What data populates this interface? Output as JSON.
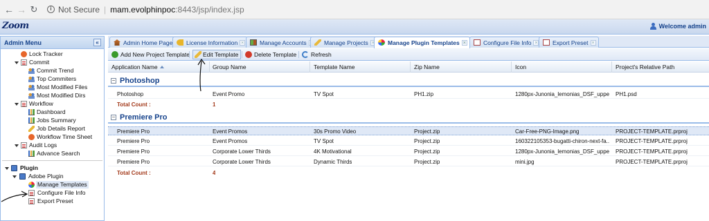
{
  "browser": {
    "security_label": "Not Secure",
    "url_host": "mam.evolphinpoc",
    "url_rest": ":8443/jsp/index.jsp"
  },
  "app": {
    "logo_text": "Zoom",
    "welcome_text": "Welcome admin"
  },
  "sidebar": {
    "title": "Admin Menu",
    "collapse_glyph": "«",
    "items": [
      {
        "label": "Lock Tracker"
      },
      {
        "label": "Commit"
      },
      {
        "label": "Commit Trend"
      },
      {
        "label": "Top Commiters"
      },
      {
        "label": "Most Modified Files"
      },
      {
        "label": "Most Modified Dirs"
      },
      {
        "label": "Workflow"
      },
      {
        "label": "Dashboard"
      },
      {
        "label": "Jobs Summary"
      },
      {
        "label": "Job Details Report"
      },
      {
        "label": "Workflow Time Sheet"
      },
      {
        "label": "Audit Logs"
      },
      {
        "label": "Advance Search"
      },
      {
        "label": "Plugin"
      },
      {
        "label": "Adobe Plugin"
      },
      {
        "label": "Manage Templates"
      },
      {
        "label": "Configure File Info"
      },
      {
        "label": "Export Preset"
      }
    ]
  },
  "tabs": [
    {
      "label": "Admin Home Page"
    },
    {
      "label": "License Information"
    },
    {
      "label": "Manage Accounts"
    },
    {
      "label": "Manage Projects"
    },
    {
      "label": "Manage Plugin Templates"
    },
    {
      "label": "Configure File Info"
    },
    {
      "label": "Export Preset"
    }
  ],
  "tab_close_glyph": "×",
  "toolbar": {
    "add": "Add New Project Template",
    "edit": "Edit Template",
    "delete": "Delete Template",
    "refresh": "Refresh"
  },
  "grid": {
    "columns": [
      "Application Name",
      "Group Name",
      "Template Name",
      "Zip Name",
      "Icon",
      "Project's Relative Path"
    ],
    "groups": [
      {
        "name": "Photoshop",
        "toggle": "−",
        "rows": [
          [
            "Photoshop",
            "Event Promo",
            "TV Spot",
            "PH1.zip",
            "1280px-Junonia_lemonias_DSF_uppe...",
            "PH1.psd"
          ]
        ],
        "total_label": "Total Count :",
        "total_value": "1"
      },
      {
        "name": "Premiere Pro",
        "toggle": "−",
        "rows": [
          [
            "Premiere Pro",
            "Event Promos",
            "30s Promo Video",
            "Project.zip",
            "Car-Free-PNG-Image.png",
            "PROJECT-TEMPLATE.prproj"
          ],
          [
            "Premiere Pro",
            "Event Promos",
            "TV Spot",
            "Project.zip",
            "160322105353-bugatti-chiron-next-fa...",
            "PROJECT-TEMPLATE.prproj"
          ],
          [
            "Premiere Pro",
            "Corporate Lower Thirds",
            "4K Motivational",
            "Project.zip",
            "1280px-Junonia_lemonias_DSF_uppe...",
            "PROJECT-TEMPLATE.prproj"
          ],
          [
            "Premiere Pro",
            "Corporate Lower Thirds",
            "Dynamic Thirds",
            "Project.zip",
            "mini.jpg",
            "PROJECT-TEMPLATE.prproj"
          ]
        ],
        "total_label": "Total Count :",
        "total_value": "4"
      }
    ]
  }
}
